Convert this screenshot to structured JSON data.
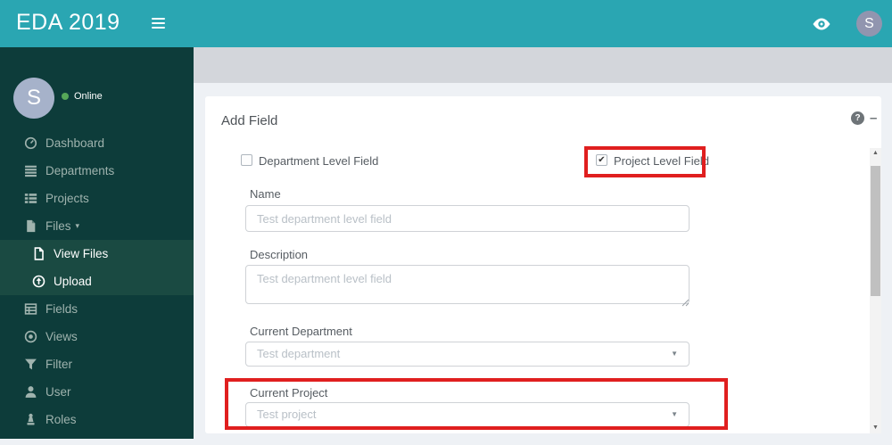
{
  "topbar": {
    "title": "EDA 2019",
    "user_initial": "S"
  },
  "sidebar": {
    "user_initial": "S",
    "status": "Online",
    "items": [
      {
        "label": "Dashboard",
        "icon": "tachometer-icon"
      },
      {
        "label": "Departments",
        "icon": "list-icon"
      },
      {
        "label": "Projects",
        "icon": "list-detail-icon"
      },
      {
        "label": "Files",
        "icon": "file-icon",
        "caret": "▾"
      },
      {
        "label": "View Files",
        "icon": "file-outline-icon",
        "submenu": true
      },
      {
        "label": "Upload",
        "icon": "upload-circle-icon",
        "submenu": true
      },
      {
        "label": "Fields",
        "icon": "table-icon"
      },
      {
        "label": "Views",
        "icon": "dot-circle-icon"
      },
      {
        "label": "Filter",
        "icon": "filter-icon"
      },
      {
        "label": "User",
        "icon": "user-icon"
      },
      {
        "label": "Roles",
        "icon": "chess-piece-icon"
      }
    ]
  },
  "panel": {
    "title": "Add Field",
    "checkboxes": [
      {
        "label": "Department Level Field",
        "checked": false
      },
      {
        "label": "Project Level Field",
        "checked": true,
        "highlighted": true
      }
    ],
    "fields": [
      {
        "label": "Name",
        "placeholder": "Test department level field"
      },
      {
        "label": "Description",
        "placeholder": "Test department level field"
      },
      {
        "label": "Current Department",
        "value": "Test department"
      },
      {
        "label": "Current Project",
        "value": "Test project",
        "highlighted": true
      }
    ]
  },
  "icons": {
    "check": "✔",
    "caret_down": "▼",
    "files_caret": "▾",
    "help": "?",
    "minimize": "—",
    "scroll_up": "▲",
    "scroll_down": "▼"
  },
  "colors": {
    "topbar": "#2aa6b2",
    "sidebar": "#0d3c3a",
    "submenu": "#1a4a42",
    "crumb_bar": "#d3d6db",
    "content_bg": "#eef1f5",
    "annotation_red": "#e01f1f",
    "status_green": "#56a758",
    "avatar": "#a6b2ca"
  }
}
